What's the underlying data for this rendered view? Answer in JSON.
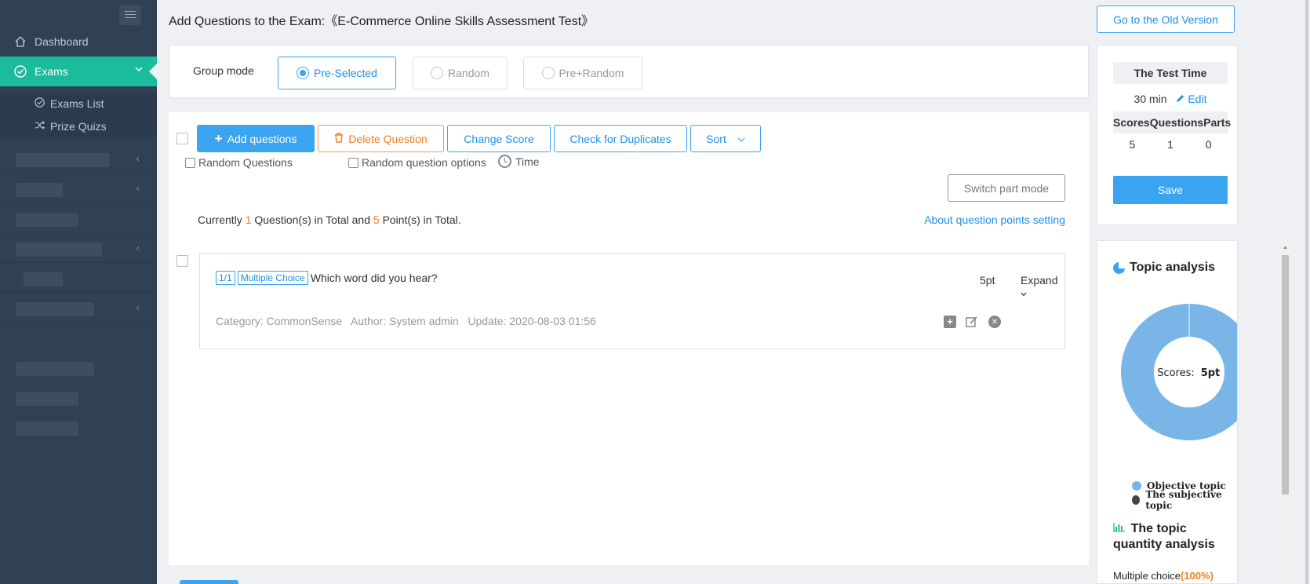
{
  "sidebar": {
    "dashboard": "Dashboard",
    "exams": "Exams",
    "sub_items": [
      "Exams List",
      "Prize Quizs"
    ]
  },
  "header": {
    "title": "Add Questions to the Exam:《E-Commerce Online Skills Assessment Test》",
    "old_version": "Go to the Old Version"
  },
  "group_mode": {
    "label": "Group mode",
    "options": [
      "Pre-Selected",
      "Random",
      "Pre+Random"
    ],
    "selected": "Pre-Selected"
  },
  "toolbar": {
    "add": "Add questions",
    "delete": "Delete Question",
    "change_score": "Change Score",
    "duplicates": "Check for Duplicates",
    "sort": "Sort"
  },
  "options": {
    "random_questions": "Random Questions",
    "random_options": "Random question options",
    "time": "Time",
    "switch_part": "Switch part mode"
  },
  "summary": {
    "prefix": "Currently",
    "questions": "1",
    "mid": "Question(s) in Total and",
    "points": "5",
    "suffix": "Point(s) in Total.",
    "points_link": "About question points setting"
  },
  "question": {
    "index": "1/1",
    "type": "Multiple Choice",
    "text": "Which word did you hear?",
    "points": "5pt",
    "expand": "Expand",
    "meta": "Category: CommonSense   Author: System admin   Update: 2020-08-03 01:56"
  },
  "test_panel": {
    "title": "The Test Time",
    "time": "30 min",
    "edit": "Edit",
    "columns": [
      "Scores",
      "Questions",
      "Parts"
    ],
    "values": [
      "5",
      "1",
      "0"
    ],
    "save": "Save"
  },
  "analysis": {
    "title": "Topic analysis",
    "center_label": "Scores:",
    "center_value": "5pt",
    "legend": [
      {
        "name": "Objective topic",
        "color": "#7ab5e8"
      },
      {
        "name": "The subjective topic",
        "color": "#444444"
      }
    ],
    "qty_title": "The topic quantity analysis",
    "qty_label": "Multiple choice",
    "qty_pct": "(100%)"
  },
  "colors": {
    "accent": "#3ba4f1",
    "sidebar": "#304156",
    "active": "#1abc9c",
    "warn": "#f07f1e"
  }
}
